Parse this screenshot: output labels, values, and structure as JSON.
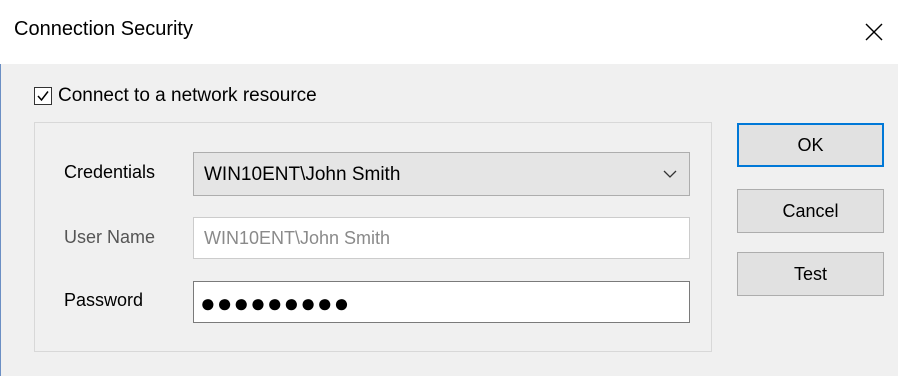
{
  "window": {
    "title": "Connection Security",
    "close_icon": "close-icon"
  },
  "connect_checkbox": {
    "label": "Connect to a network resource",
    "checked": true
  },
  "credentials": {
    "label": "Credentials",
    "selected": "WIN10ENT\\John Smith",
    "arrow_icon": "chevron-down-icon"
  },
  "username": {
    "label": "User Name",
    "value": "WIN10ENT\\John Smith"
  },
  "password": {
    "label": "Password",
    "value": "●●●●●●●●●"
  },
  "buttons": {
    "ok": "OK",
    "cancel": "Cancel",
    "test": "Test"
  },
  "colors": {
    "accent": "#0078d7",
    "dialog_bg": "#f0f0f0"
  }
}
